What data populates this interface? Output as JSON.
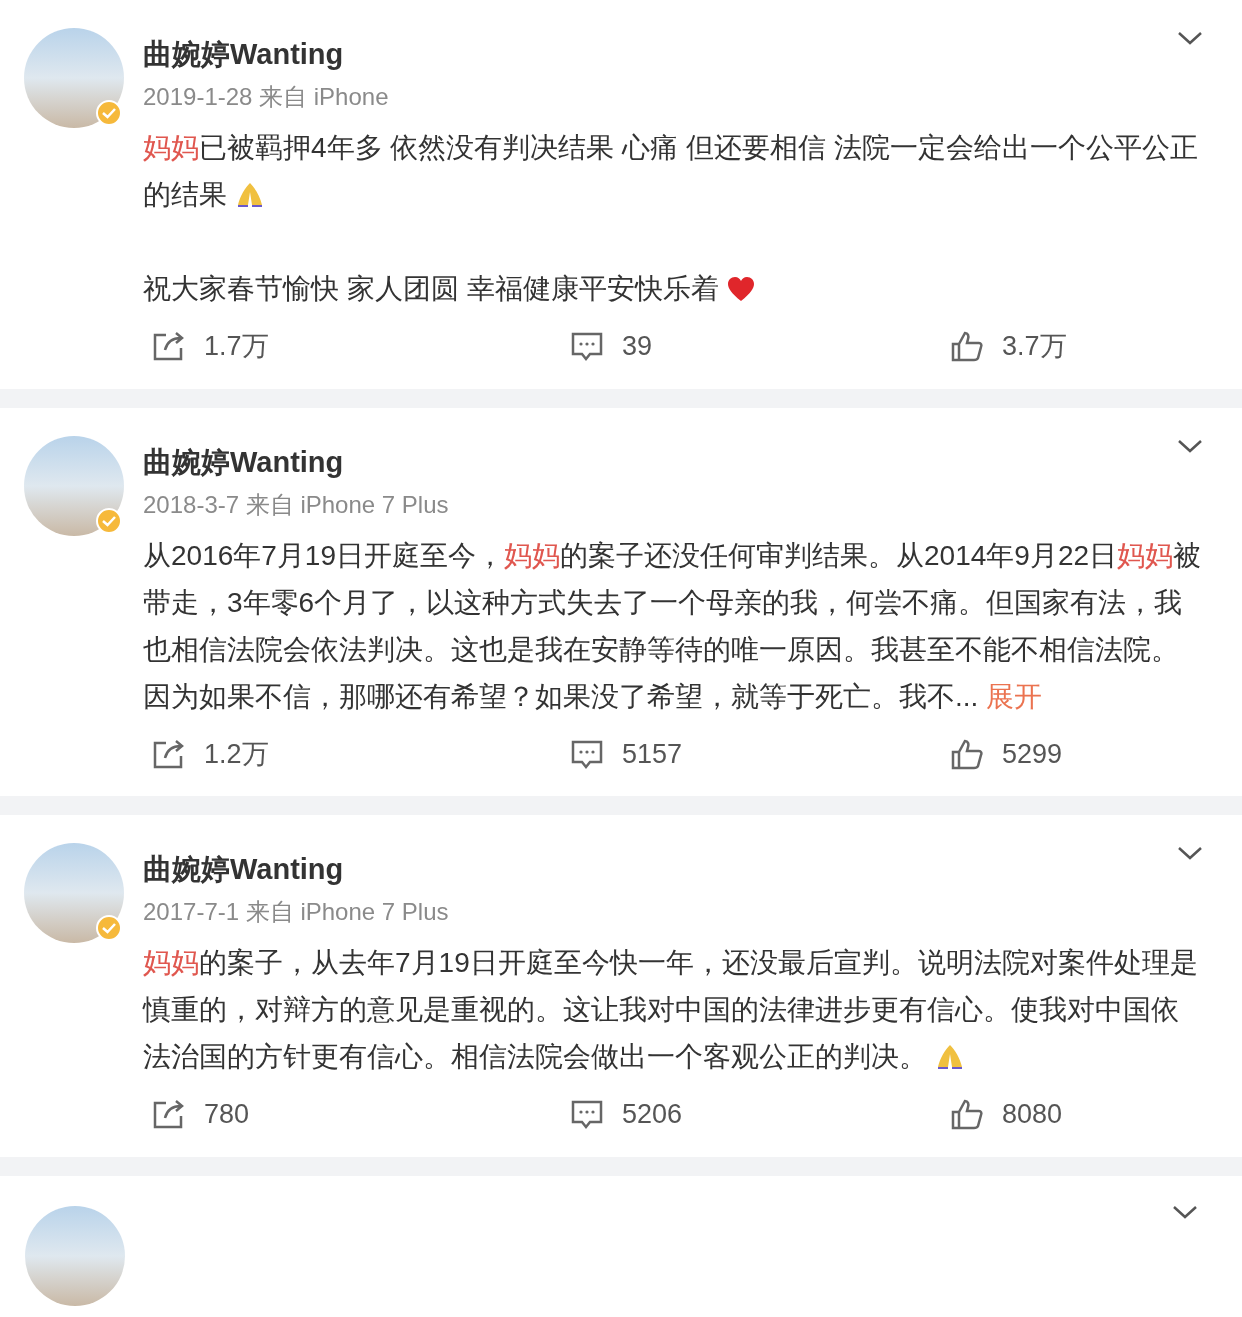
{
  "posts": [
    {
      "author": "曲婉婷Wanting",
      "verified": true,
      "meta": "2019-1-28 来自 iPhone",
      "paragraphs": [
        [
          {
            "kind": "keyword",
            "text": "妈妈"
          },
          {
            "kind": "text",
            "text": "已被羁押4年多 依然没有判决结果 心痛 但还要相信 法院一定会给出一个公平公正的结果 "
          },
          {
            "kind": "pray"
          }
        ],
        [
          {
            "kind": "text",
            "text": "祝大家春节愉快 家人团圆 幸福健康平安快乐着 "
          },
          {
            "kind": "heart"
          }
        ]
      ],
      "reposts": "1.7万",
      "comments": "39",
      "likes": "3.7万"
    },
    {
      "author": "曲婉婷Wanting",
      "verified": true,
      "meta": "2018-3-7 来自 iPhone 7 Plus",
      "paragraphs": [
        [
          {
            "kind": "text",
            "text": "从2016年7月19日开庭至今，"
          },
          {
            "kind": "keyword",
            "text": "妈妈"
          },
          {
            "kind": "text",
            "text": "的案子还没任何审判结果。从2014年9月22日"
          },
          {
            "kind": "keyword",
            "text": "妈妈"
          },
          {
            "kind": "text",
            "text": "被带走，3年零6个月了，以这种方式失去了一个母亲的我，何尝不痛。但国家有法，我也相信法院会依法判决。这也是我在安静等待的唯一原因。我甚至不能不相信法院。因为如果不信，那哪还有希望？如果没了希望，就等于死亡。我不"
          },
          {
            "kind": "ellipsis",
            "text": "..."
          },
          {
            "kind": "expand",
            "text": "展开"
          }
        ]
      ],
      "reposts": "1.2万",
      "comments": "5157",
      "likes": "5299"
    },
    {
      "author": "曲婉婷Wanting",
      "verified": true,
      "meta": "2017-7-1 来自 iPhone 7 Plus",
      "paragraphs": [
        [
          {
            "kind": "keyword",
            "text": "妈妈"
          },
          {
            "kind": "text",
            "text": "的案子，从去年7月19日开庭至今快一年，还没最后宣判。说明法院对案件处理是慎重的，对辩方的意见是重视的。这让我对中国的法律进步更有信心。使我对中国依法治国的方针更有信心。相信法院会做出一个客观公正的判决。 "
          },
          {
            "kind": "pray"
          }
        ]
      ],
      "reposts": "780",
      "comments": "5206",
      "likes": "8080"
    },
    {
      "partial": true
    }
  ]
}
